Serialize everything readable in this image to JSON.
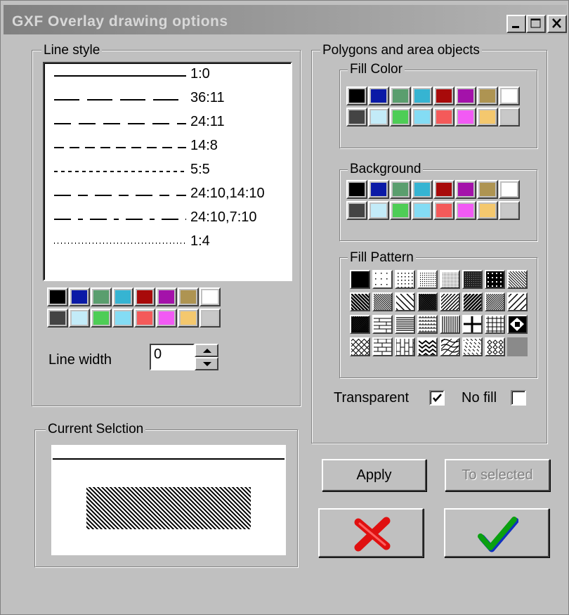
{
  "window": {
    "title": "GXF Overlay drawing options",
    "controls": [
      "minimize-icon",
      "maximize-icon",
      "close-icon"
    ]
  },
  "line_style": {
    "group_label": "Line style",
    "items": [
      {
        "label": "1:0"
      },
      {
        "label": "36:11"
      },
      {
        "label": "24:11"
      },
      {
        "label": "14:8"
      },
      {
        "label": "5:5"
      },
      {
        "label": "24:10,14:10"
      },
      {
        "label": "24:10,7:10"
      },
      {
        "label": "1:4"
      }
    ],
    "line_width_label": "Line width",
    "line_width_value": "0"
  },
  "palette": {
    "row1": [
      "#000000",
      "#0a1aa6",
      "#5a9e6e",
      "#36b4d2",
      "#a80a0a",
      "#a412aa",
      "#ae9452",
      "#ffffff"
    ],
    "row2": [
      "#444444",
      "#c3ebf8",
      "#4ecd56",
      "#84dcf4",
      "#f45a5a",
      "#f25af4",
      "#f4c86e",
      "#c8c8c8"
    ]
  },
  "polygons": {
    "group_label": "Polygons and area objects",
    "fill_color_label": "Fill Color",
    "background_label": "Background",
    "fill_pattern_label": "Fill Pattern",
    "fill_patterns": [
      "solid",
      "sparse-dots",
      "dots",
      "dense-dots",
      "fine-grid",
      "dark-dots",
      "black-dots",
      "diag-back",
      "diag-back-thick",
      "diag-back-fine",
      "diag-back-wide",
      "diag-back-dense",
      "diag-fwd",
      "diag-fwd-thick",
      "diag-fwd-fine",
      "diag-fwd-wide",
      "diag-fwd-dense",
      "brick-h",
      "horiz-lines",
      "weave",
      "vert-lines",
      "cross",
      "grid",
      "checker-x",
      "diag-cross",
      "brick",
      "brick-v",
      "zigzag",
      "wave",
      "diag-dash",
      "diamonds",
      "gray-solid"
    ],
    "transparent_label": "Transparent",
    "transparent_checked": true,
    "no_fill_label": "No fill",
    "no_fill_checked": false
  },
  "current_selection": {
    "group_label": "Current Selction"
  },
  "buttons": {
    "apply": "Apply",
    "to_selected": "To selected",
    "cancel_icon": "red-x-icon",
    "ok_icon": "green-check-icon"
  }
}
